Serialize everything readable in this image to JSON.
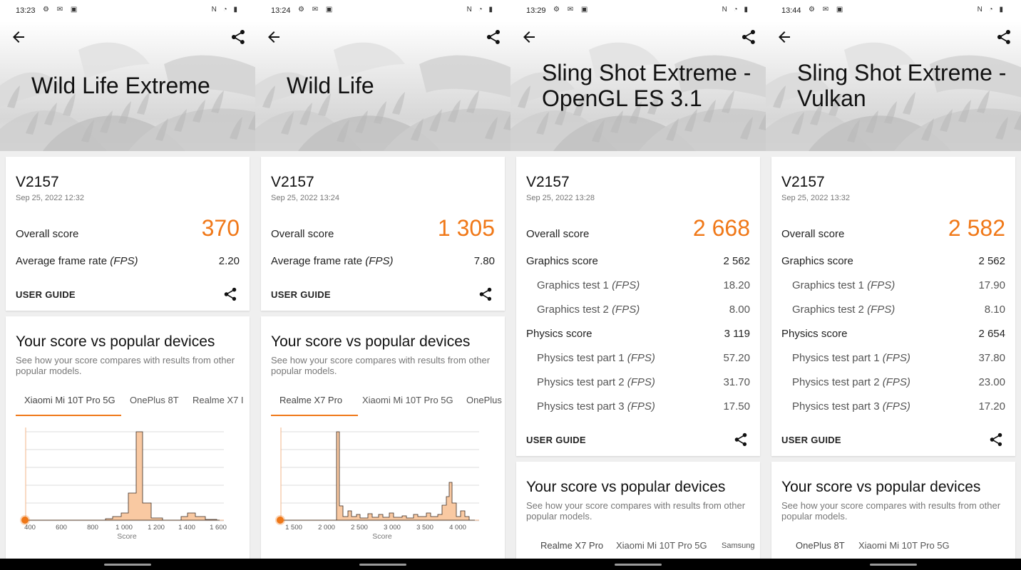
{
  "accent_color": "#f07818",
  "screens": [
    {
      "time": "13:23",
      "title_lines": [
        "Wild Life Extreme"
      ],
      "device": "V2157",
      "date": "Sep 25, 2022 12:32",
      "overall_label": "Overall score",
      "overall_value": "370",
      "rows": [
        {
          "label": "Average frame rate",
          "unit": "(FPS)",
          "value": "2.20",
          "sub": false
        }
      ],
      "user_guide": "USER GUIDE",
      "compare_title": "Your score vs popular devices",
      "compare_desc": "See how your score compares with results from other popular models.",
      "tabs": [
        "Xiaomi Mi 10T Pro 5G",
        "OnePlus 8T",
        "Realme X7 I"
      ],
      "active_tab": 0,
      "chart": {
        "xlabel": "Score",
        "ticks": [
          "400",
          "600",
          "800",
          "1 000",
          "1 200",
          "1 400",
          "1 600"
        ],
        "marker": "370"
      }
    },
    {
      "time": "13:24",
      "title_lines": [
        "Wild Life"
      ],
      "device": "V2157",
      "date": "Sep 25, 2022 13:24",
      "overall_label": "Overall score",
      "overall_value": "1 305",
      "rows": [
        {
          "label": "Average frame rate",
          "unit": "(FPS)",
          "value": "7.80",
          "sub": false
        }
      ],
      "user_guide": "USER GUIDE",
      "compare_title": "Your score vs popular devices",
      "compare_desc": "See how your score compares with results from other popular models.",
      "tabs": [
        "Realme X7 Pro",
        "Xiaomi Mi 10T Pro 5G",
        "OnePlus"
      ],
      "active_tab": 0,
      "chart": {
        "xlabel": "Score",
        "ticks": [
          "1 500",
          "2 000",
          "2 500",
          "3 000",
          "3 500",
          "4 000"
        ],
        "marker": "1 305"
      }
    },
    {
      "time": "13:29",
      "title_lines": [
        "Sling Shot Extreme -",
        "OpenGL ES 3.1"
      ],
      "device": "V2157",
      "date": "Sep 25, 2022 13:28",
      "overall_label": "Overall score",
      "overall_value": "2 668",
      "rows": [
        {
          "label": "Graphics score",
          "unit": "",
          "value": "2 562",
          "sub": false
        },
        {
          "label": "Graphics test 1",
          "unit": "(FPS)",
          "value": "18.20",
          "sub": true
        },
        {
          "label": "Graphics test 2",
          "unit": "(FPS)",
          "value": "8.00",
          "sub": true
        },
        {
          "label": "Physics score",
          "unit": "",
          "value": "3 119",
          "sub": false
        },
        {
          "label": "Physics test part 1",
          "unit": "(FPS)",
          "value": "57.20",
          "sub": true
        },
        {
          "label": "Physics test part 2",
          "unit": "(FPS)",
          "value": "31.70",
          "sub": true
        },
        {
          "label": "Physics test part 3",
          "unit": "(FPS)",
          "value": "17.50",
          "sub": true
        }
      ],
      "user_guide": "USER GUIDE",
      "compare_title": "Your score vs popular devices",
      "compare_desc": "See how your score compares with results from other popular models.",
      "tabs": [
        "Realme X7 Pro",
        "Xiaomi Mi 10T Pro 5G",
        "Samsung"
      ],
      "active_tab": 0
    },
    {
      "time": "13:44",
      "title_lines": [
        "Sling Shot Extreme -",
        "Vulkan"
      ],
      "device": "V2157",
      "date": "Sep 25, 2022 13:32",
      "overall_label": "Overall score",
      "overall_value": "2 582",
      "rows": [
        {
          "label": "Graphics score",
          "unit": "",
          "value": "2 562",
          "sub": false
        },
        {
          "label": "Graphics test 1",
          "unit": "(FPS)",
          "value": "17.90",
          "sub": true
        },
        {
          "label": "Graphics test 2",
          "unit": "(FPS)",
          "value": "8.10",
          "sub": true
        },
        {
          "label": "Physics score",
          "unit": "",
          "value": "2 654",
          "sub": false
        },
        {
          "label": "Physics test part 1",
          "unit": "(FPS)",
          "value": "37.80",
          "sub": true
        },
        {
          "label": "Physics test part 2",
          "unit": "(FPS)",
          "value": "23.00",
          "sub": true
        },
        {
          "label": "Physics test part 3",
          "unit": "(FPS)",
          "value": "17.20",
          "sub": true
        }
      ],
      "user_guide": "USER GUIDE",
      "compare_title": "Your score vs popular devices",
      "compare_desc": "See how your score compares with results from other popular models.",
      "tabs": [
        "OnePlus 8T",
        "Xiaomi Mi 10T Pro 5G"
      ],
      "active_tab": 0
    }
  ]
}
